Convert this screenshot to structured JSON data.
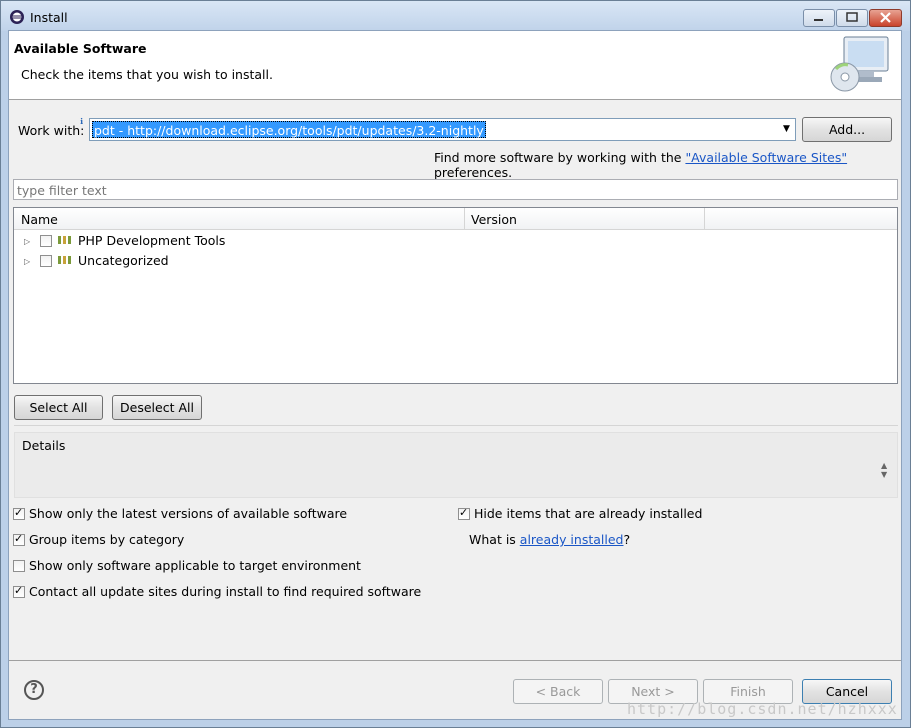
{
  "window": {
    "title": "Install"
  },
  "header": {
    "title": "Available Software",
    "description": "Check the items that you wish to install."
  },
  "work_with": {
    "label": "Work with:",
    "value": "pdt - http://download.eclipse.org/tools/pdt/updates/3.2-nightly",
    "add_label": "Add...",
    "find_more_prefix": "Find more software by working with the ",
    "find_more_link": "\"Available Software Sites\"",
    "find_more_suffix": " preferences."
  },
  "filter": {
    "placeholder": "type filter text"
  },
  "tree": {
    "columns": [
      "Name",
      "Version"
    ],
    "items": [
      {
        "name": "PHP Development Tools",
        "checked": false
      },
      {
        "name": "Uncategorized",
        "checked": false
      }
    ]
  },
  "buttons": {
    "select_all": "Select All",
    "deselect_all": "Deselect All"
  },
  "details": {
    "label": "Details"
  },
  "options": {
    "latest_versions": {
      "label": "Show only the latest versions of available software",
      "checked": true
    },
    "group_by_category": {
      "label": "Group items by category",
      "checked": true
    },
    "applicable_only": {
      "label": "Show only software applicable to target environment",
      "checked": false
    },
    "contact_all_sites": {
      "label": "Contact all update sites during install to find required software",
      "checked": true
    },
    "hide_installed": {
      "label": "Hide items that are already installed",
      "checked": true
    },
    "what_is_prefix": "What is ",
    "what_is_link": "already installed",
    "what_is_suffix": "?"
  },
  "footer": {
    "back": "< Back",
    "next": "Next >",
    "finish": "Finish",
    "cancel": "Cancel"
  },
  "watermark": "http://blog.csdn.net/hzhxxx"
}
